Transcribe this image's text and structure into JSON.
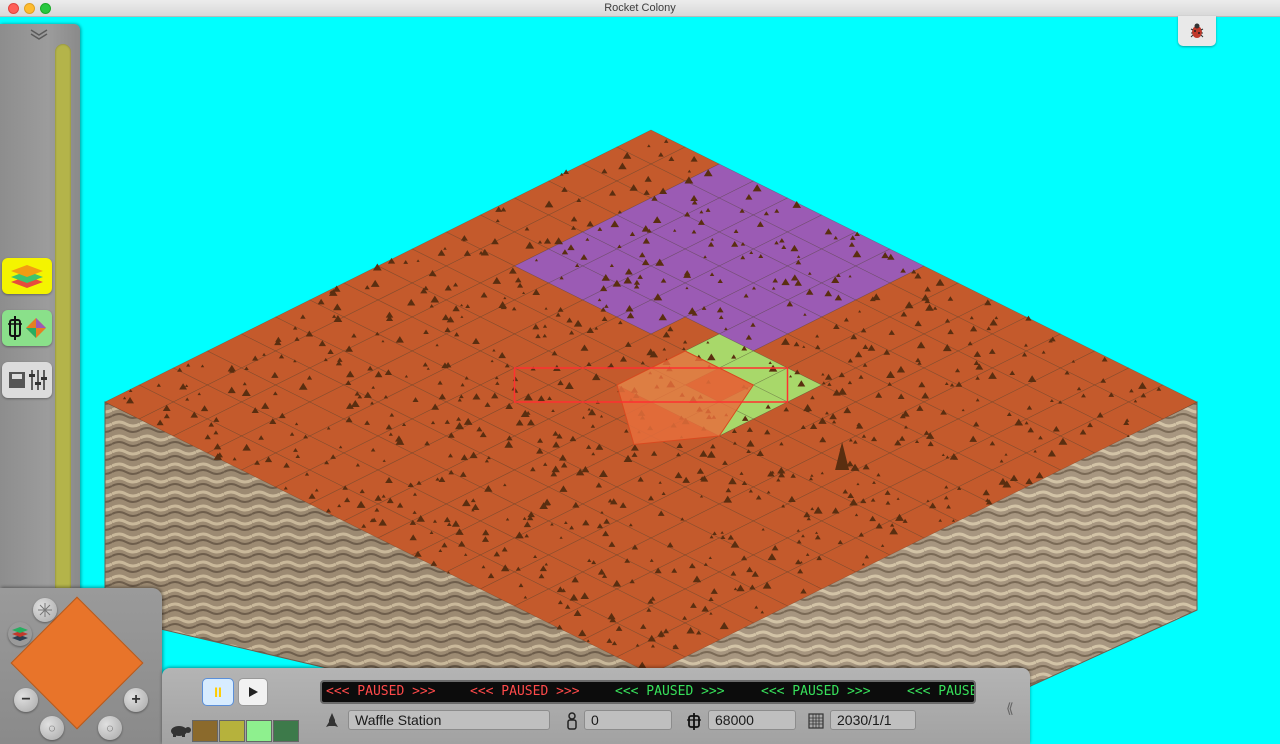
{
  "window": {
    "title": "Rocket Colony"
  },
  "ticker": [
    {
      "text": "<<< PAUSED >>>",
      "color": "red"
    },
    {
      "text": "<<< PAUSED >>>",
      "color": "red"
    },
    {
      "text": "<<< PAUSED >>>",
      "color": "green"
    },
    {
      "text": "<<< PAUSED >>>",
      "color": "green"
    },
    {
      "text": "<<< PAUSED >>>",
      "color": "green"
    }
  ],
  "status": {
    "colony_name": "Waffle Station",
    "population": "0",
    "funds": "68000",
    "date": "2030/1/1"
  },
  "toolbar": {
    "pause_label": "II",
    "tools": [
      "layers-tool",
      "stats-tool",
      "settings-tool"
    ],
    "swatches": [
      "#8b6a2c",
      "#b6b23c",
      "#8ef08e",
      "#3d7a4a"
    ]
  },
  "map": {
    "grid_size": 16,
    "terrain_color": "#c45a2c",
    "purple_zone_color": "#9b5bb4",
    "green_zone_color": "#a8d86a"
  }
}
